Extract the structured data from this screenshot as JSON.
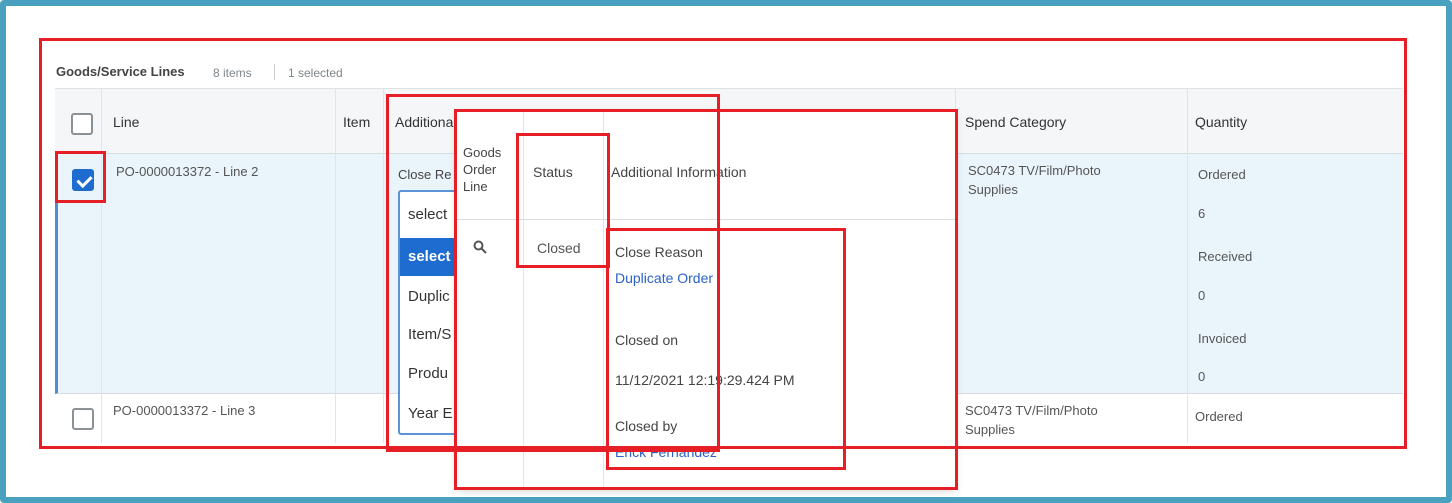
{
  "header": {
    "title": "Goods/Service Lines",
    "item_count": "8 items",
    "selected_count": "1 selected"
  },
  "columns": {
    "line": "Line",
    "item": "Item",
    "additional": "Additiona",
    "spend_category": "Spend Category",
    "quantity": "Quantity"
  },
  "rows": [
    {
      "line": "PO-0000013372 - Line 2",
      "spend_category_1": "SC0473 TV/Film/Photo",
      "spend_category_2": "Supplies",
      "quantity": {
        "ordered_label": "Ordered",
        "ordered": "6",
        "received_label": "Received",
        "received": "0",
        "invoiced_label": "Invoiced",
        "invoiced": "0"
      },
      "close_reason_label": "Close Re",
      "close_reason_select": "select"
    },
    {
      "line": "PO-0000013372 - Line 3",
      "spend_category_1": "SC0473 TV/Film/Photo",
      "spend_category_2": "Supplies",
      "quantity_label": "Ordered"
    }
  ],
  "dropdown_options": [
    "select",
    "Duplic",
    "Item/S",
    "Produ",
    "Year E"
  ],
  "popup": {
    "col_goods_1": "Goods",
    "col_goods_2": "Order",
    "col_goods_3": "Line",
    "col_status": "Status",
    "col_info": "Additional Information",
    "status_value": "Closed",
    "close_reason_label": "Close Reason",
    "close_reason_value": "Duplicate Order",
    "closed_on_label": "Closed on",
    "closed_on_value": "11/12/2021 12:19:29.424 PM",
    "closed_by_label": "Closed by",
    "closed_by_value": "Erick Fernandez"
  },
  "colors": {
    "frame": "#4aa1bf",
    "highlight": "#e61e25",
    "link": "#2a62c9",
    "selected": "#1e6ccf"
  }
}
